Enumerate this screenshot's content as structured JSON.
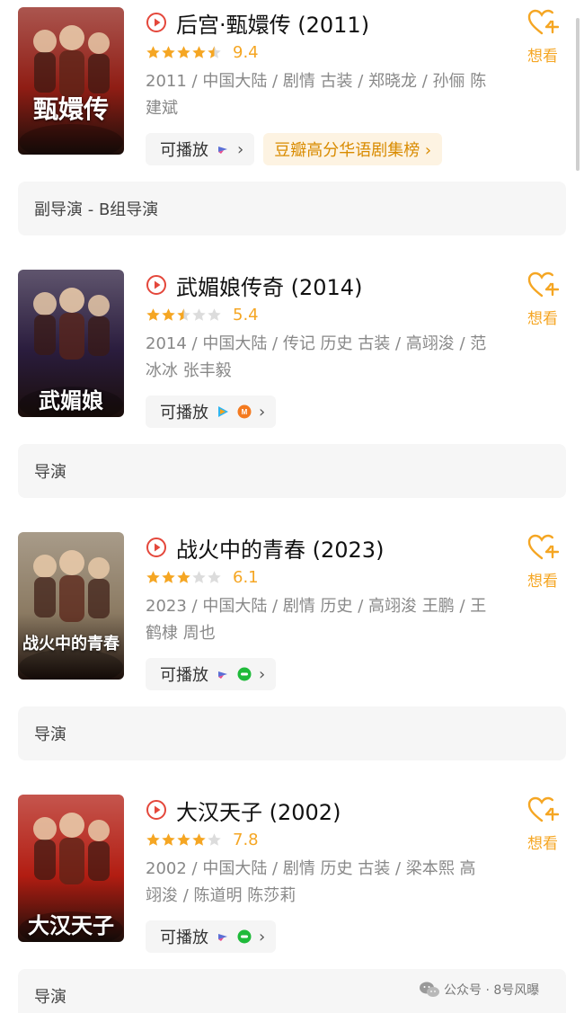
{
  "entries": [
    {
      "title": "后宫·甄嬛传 (2011)",
      "score": "9.4",
      "stars": 4.5,
      "meta": "2011 / 中国大陆 / 剧情 古装 / 郑晓龙 / 孙俪 陈建斌",
      "play_label": "可播放",
      "rank_label": "豆瓣高分华语剧集榜 ›",
      "wish_label": "想看",
      "role": "副导演 - B组导演",
      "poster_text": "甄嬛传",
      "poster_color": "#8f1d14",
      "app_icons": [
        "bilibili-tv-icon"
      ]
    },
    {
      "title": "武媚娘传奇 (2014)",
      "score": "5.4",
      "stars": 2.5,
      "meta": "2014 / 中国大陆 / 传记 历史 古装 / 高翊浚 / 范冰冰 张丰毅",
      "play_label": "可播放",
      "wish_label": "想看",
      "role": "导演",
      "poster_text": "武媚娘",
      "poster_color": "#2a1c3d",
      "app_icons": [
        "tencent-video-icon",
        "mango-tv-icon"
      ]
    },
    {
      "title": "战火中的青春 (2023)",
      "score": "6.1",
      "stars": 3,
      "meta": "2023 / 中国大陆 / 剧情 历史 / 高翊浚 王鹏 / 王鹤棣 周也",
      "play_label": "可播放",
      "wish_label": "想看",
      "role": "导演",
      "poster_text": "战火中的青春",
      "poster_color": "#8b7a62",
      "app_icons": [
        "bilibili-tv-icon",
        "iqiyi-icon"
      ]
    },
    {
      "title": "大汉天子 (2002)",
      "score": "7.8",
      "stars": 4,
      "meta": "2002 / 中国大陆 / 剧情 历史 古装 / 梁本熙 高翊浚 / 陈道明 陈莎莉",
      "play_label": "可播放",
      "wish_label": "想看",
      "role": "导演",
      "poster_text": "大汉天子",
      "poster_color": "#b21d12",
      "app_icons": [
        "bilibili-tv-icon",
        "iqiyi-icon"
      ]
    }
  ],
  "watermark": "公众号 · 8号风曝",
  "colors": {
    "accent": "#f5a623",
    "play_red": "#e4473b",
    "star_empty": "#dcdcdc"
  }
}
